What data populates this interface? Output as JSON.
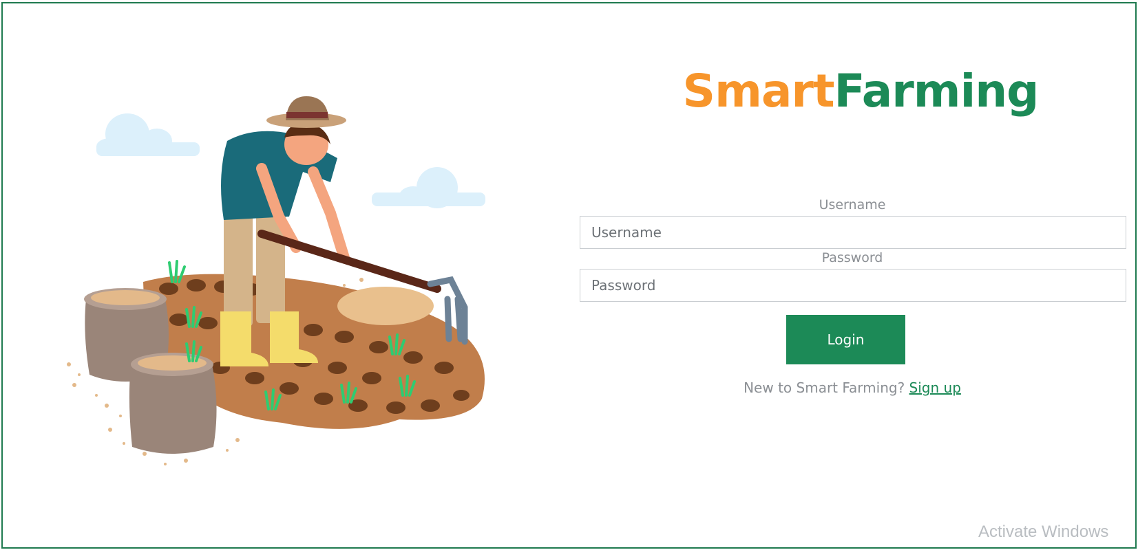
{
  "brand": {
    "part1": "Smart",
    "part2": "Farming",
    "color1": "#f7952b",
    "color2": "#1c8a57"
  },
  "form": {
    "username_label": "Username",
    "username_placeholder": "Username",
    "password_label": "Password",
    "password_placeholder": "Password",
    "login_label": "Login",
    "signup_prompt": "New to Smart Farming?",
    "signup_link": "Sign up"
  },
  "watermark": "Activate Windows",
  "colors": {
    "accent": "#1c8a57",
    "border": "#1f7a4f"
  }
}
